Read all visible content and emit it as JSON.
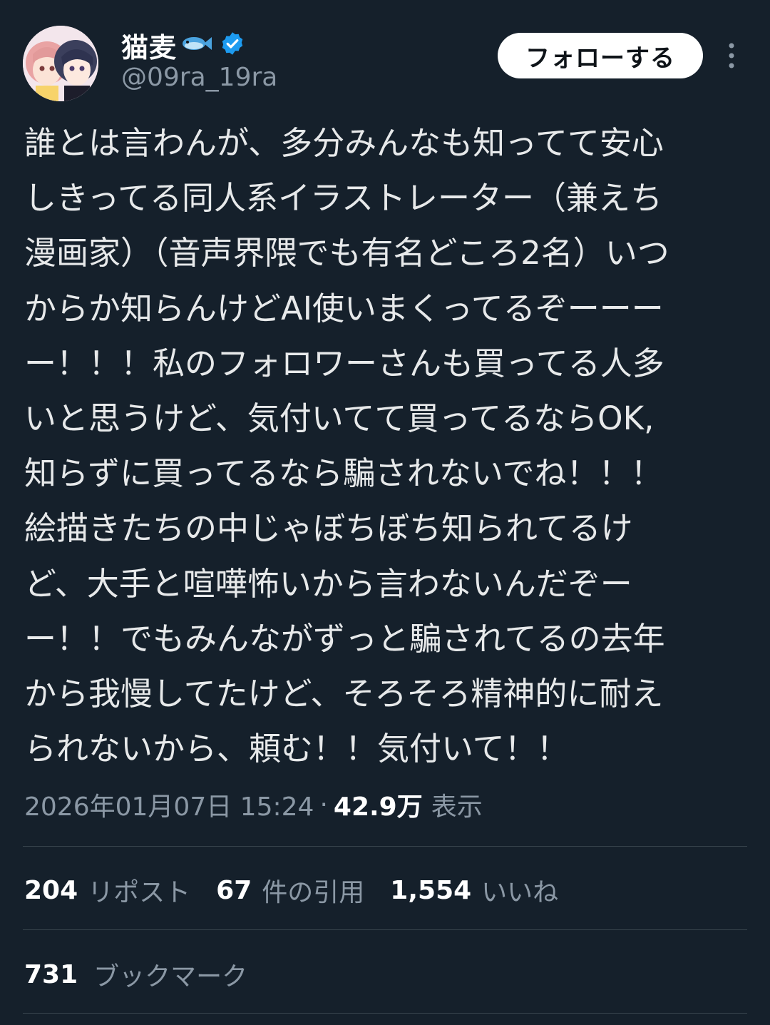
{
  "author": {
    "display_name": "猫麦",
    "handle": "@09ra_19ra",
    "avatar_icon": "anime-avatar-icon",
    "name_emoji_icon": "fish-icon",
    "verified_icon": "verified-badge-icon"
  },
  "actions": {
    "follow_label": "フォローする",
    "more_icon": "more-vertical-icon"
  },
  "tweet": {
    "lines": [
      "誰とは言わんが、多分みんなも知ってて安心",
      "しきってる同人系イラストレーター（兼えち",
      "漫画家）（音声界隈でも有名どころ2名）いつ",
      "からか知らんけどAI使いまくってるぞーーー",
      "ー！！！私のフォロワーさんも買ってる人多",
      "いと思うけど、気付いてて買ってるならOK,",
      "知らずに買ってるなら騙されないでね！！！",
      "絵描きたちの中じゃぼちぼち知られてるけ",
      "ど、大手と喧嘩怖いから言わないんだぞー",
      "ー！！でもみんながずっと騙されてるの去年",
      "から我慢してたけど、そろそろ精神的に耐え",
      "られないから、頼む！！気付いて！！"
    ]
  },
  "meta": {
    "timestamp": "2026年01月07日 15:24",
    "separator": "·",
    "views_count": "42.9万",
    "views_label": "表示"
  },
  "stats": {
    "reposts_count": "204",
    "reposts_label": "リポスト",
    "quotes_count": "67",
    "quotes_label": "件の引用",
    "likes_count": "1,554",
    "likes_label": "いいね"
  },
  "bookmarks": {
    "count": "731",
    "label": "ブックマーク"
  },
  "colors": {
    "background": "#15202b",
    "text": "#e7e9ea",
    "secondary_text": "#8b98a5",
    "divider": "#38444d",
    "verified": "#1d9bf0",
    "follow_button_bg": "#ffffff"
  }
}
